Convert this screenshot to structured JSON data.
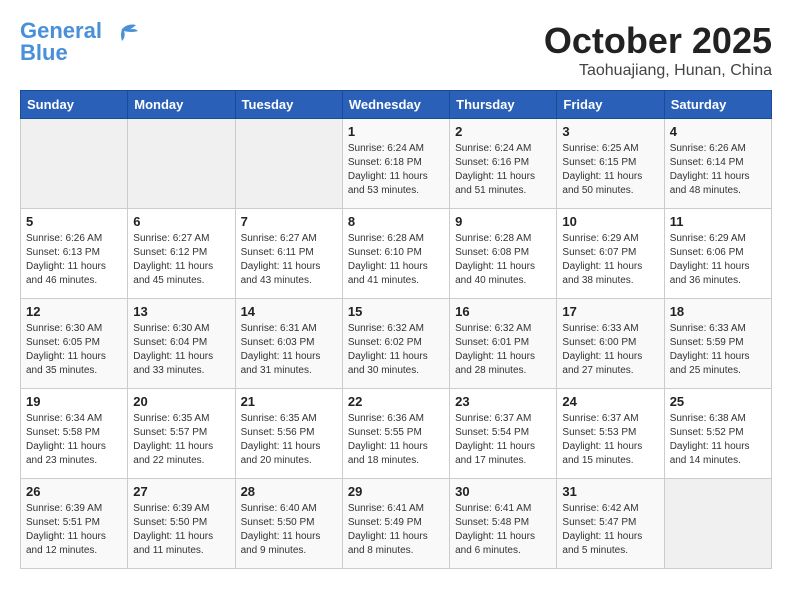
{
  "logo": {
    "line1": "General",
    "line2": "Blue"
  },
  "title": "October 2025",
  "location": "Taohuajiang, Hunan, China",
  "weekdays": [
    "Sunday",
    "Monday",
    "Tuesday",
    "Wednesday",
    "Thursday",
    "Friday",
    "Saturday"
  ],
  "weeks": [
    [
      {
        "day": "",
        "sunrise": "",
        "sunset": "",
        "daylight": ""
      },
      {
        "day": "",
        "sunrise": "",
        "sunset": "",
        "daylight": ""
      },
      {
        "day": "",
        "sunrise": "",
        "sunset": "",
        "daylight": ""
      },
      {
        "day": "1",
        "sunrise": "Sunrise: 6:24 AM",
        "sunset": "Sunset: 6:18 PM",
        "daylight": "Daylight: 11 hours and 53 minutes."
      },
      {
        "day": "2",
        "sunrise": "Sunrise: 6:24 AM",
        "sunset": "Sunset: 6:16 PM",
        "daylight": "Daylight: 11 hours and 51 minutes."
      },
      {
        "day": "3",
        "sunrise": "Sunrise: 6:25 AM",
        "sunset": "Sunset: 6:15 PM",
        "daylight": "Daylight: 11 hours and 50 minutes."
      },
      {
        "day": "4",
        "sunrise": "Sunrise: 6:26 AM",
        "sunset": "Sunset: 6:14 PM",
        "daylight": "Daylight: 11 hours and 48 minutes."
      }
    ],
    [
      {
        "day": "5",
        "sunrise": "Sunrise: 6:26 AM",
        "sunset": "Sunset: 6:13 PM",
        "daylight": "Daylight: 11 hours and 46 minutes."
      },
      {
        "day": "6",
        "sunrise": "Sunrise: 6:27 AM",
        "sunset": "Sunset: 6:12 PM",
        "daylight": "Daylight: 11 hours and 45 minutes."
      },
      {
        "day": "7",
        "sunrise": "Sunrise: 6:27 AM",
        "sunset": "Sunset: 6:11 PM",
        "daylight": "Daylight: 11 hours and 43 minutes."
      },
      {
        "day": "8",
        "sunrise": "Sunrise: 6:28 AM",
        "sunset": "Sunset: 6:10 PM",
        "daylight": "Daylight: 11 hours and 41 minutes."
      },
      {
        "day": "9",
        "sunrise": "Sunrise: 6:28 AM",
        "sunset": "Sunset: 6:08 PM",
        "daylight": "Daylight: 11 hours and 40 minutes."
      },
      {
        "day": "10",
        "sunrise": "Sunrise: 6:29 AM",
        "sunset": "Sunset: 6:07 PM",
        "daylight": "Daylight: 11 hours and 38 minutes."
      },
      {
        "day": "11",
        "sunrise": "Sunrise: 6:29 AM",
        "sunset": "Sunset: 6:06 PM",
        "daylight": "Daylight: 11 hours and 36 minutes."
      }
    ],
    [
      {
        "day": "12",
        "sunrise": "Sunrise: 6:30 AM",
        "sunset": "Sunset: 6:05 PM",
        "daylight": "Daylight: 11 hours and 35 minutes."
      },
      {
        "day": "13",
        "sunrise": "Sunrise: 6:30 AM",
        "sunset": "Sunset: 6:04 PM",
        "daylight": "Daylight: 11 hours and 33 minutes."
      },
      {
        "day": "14",
        "sunrise": "Sunrise: 6:31 AM",
        "sunset": "Sunset: 6:03 PM",
        "daylight": "Daylight: 11 hours and 31 minutes."
      },
      {
        "day": "15",
        "sunrise": "Sunrise: 6:32 AM",
        "sunset": "Sunset: 6:02 PM",
        "daylight": "Daylight: 11 hours and 30 minutes."
      },
      {
        "day": "16",
        "sunrise": "Sunrise: 6:32 AM",
        "sunset": "Sunset: 6:01 PM",
        "daylight": "Daylight: 11 hours and 28 minutes."
      },
      {
        "day": "17",
        "sunrise": "Sunrise: 6:33 AM",
        "sunset": "Sunset: 6:00 PM",
        "daylight": "Daylight: 11 hours and 27 minutes."
      },
      {
        "day": "18",
        "sunrise": "Sunrise: 6:33 AM",
        "sunset": "Sunset: 5:59 PM",
        "daylight": "Daylight: 11 hours and 25 minutes."
      }
    ],
    [
      {
        "day": "19",
        "sunrise": "Sunrise: 6:34 AM",
        "sunset": "Sunset: 5:58 PM",
        "daylight": "Daylight: 11 hours and 23 minutes."
      },
      {
        "day": "20",
        "sunrise": "Sunrise: 6:35 AM",
        "sunset": "Sunset: 5:57 PM",
        "daylight": "Daylight: 11 hours and 22 minutes."
      },
      {
        "day": "21",
        "sunrise": "Sunrise: 6:35 AM",
        "sunset": "Sunset: 5:56 PM",
        "daylight": "Daylight: 11 hours and 20 minutes."
      },
      {
        "day": "22",
        "sunrise": "Sunrise: 6:36 AM",
        "sunset": "Sunset: 5:55 PM",
        "daylight": "Daylight: 11 hours and 18 minutes."
      },
      {
        "day": "23",
        "sunrise": "Sunrise: 6:37 AM",
        "sunset": "Sunset: 5:54 PM",
        "daylight": "Daylight: 11 hours and 17 minutes."
      },
      {
        "day": "24",
        "sunrise": "Sunrise: 6:37 AM",
        "sunset": "Sunset: 5:53 PM",
        "daylight": "Daylight: 11 hours and 15 minutes."
      },
      {
        "day": "25",
        "sunrise": "Sunrise: 6:38 AM",
        "sunset": "Sunset: 5:52 PM",
        "daylight": "Daylight: 11 hours and 14 minutes."
      }
    ],
    [
      {
        "day": "26",
        "sunrise": "Sunrise: 6:39 AM",
        "sunset": "Sunset: 5:51 PM",
        "daylight": "Daylight: 11 hours and 12 minutes."
      },
      {
        "day": "27",
        "sunrise": "Sunrise: 6:39 AM",
        "sunset": "Sunset: 5:50 PM",
        "daylight": "Daylight: 11 hours and 11 minutes."
      },
      {
        "day": "28",
        "sunrise": "Sunrise: 6:40 AM",
        "sunset": "Sunset: 5:50 PM",
        "daylight": "Daylight: 11 hours and 9 minutes."
      },
      {
        "day": "29",
        "sunrise": "Sunrise: 6:41 AM",
        "sunset": "Sunset: 5:49 PM",
        "daylight": "Daylight: 11 hours and 8 minutes."
      },
      {
        "day": "30",
        "sunrise": "Sunrise: 6:41 AM",
        "sunset": "Sunset: 5:48 PM",
        "daylight": "Daylight: 11 hours and 6 minutes."
      },
      {
        "day": "31",
        "sunrise": "Sunrise: 6:42 AM",
        "sunset": "Sunset: 5:47 PM",
        "daylight": "Daylight: 11 hours and 5 minutes."
      },
      {
        "day": "",
        "sunrise": "",
        "sunset": "",
        "daylight": ""
      }
    ]
  ]
}
